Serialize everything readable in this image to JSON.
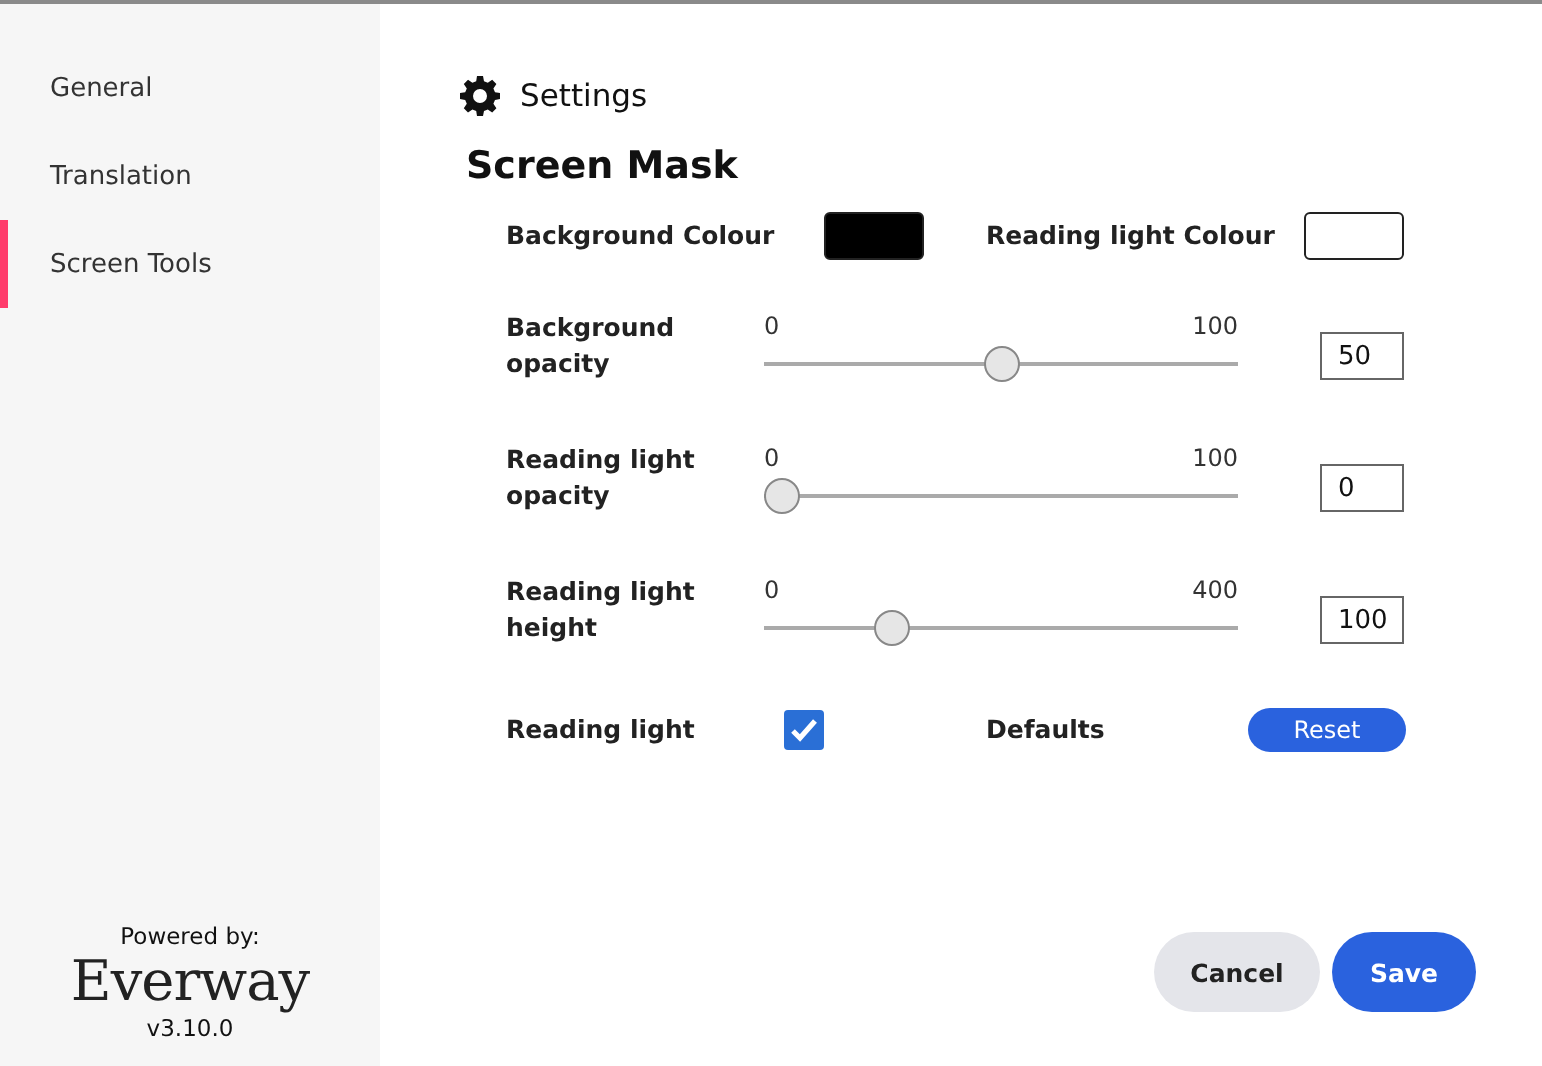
{
  "sidebar": {
    "items": [
      {
        "label": "General",
        "selected": false
      },
      {
        "label": "Translation",
        "selected": false
      },
      {
        "label": "Screen Tools",
        "selected": true
      }
    ],
    "footer": {
      "powered_by": "Powered by:",
      "logo": "Everway",
      "version": "v3.10.0"
    }
  },
  "header": {
    "title": "Settings"
  },
  "section": {
    "title": "Screen Mask"
  },
  "colours": [
    {
      "label": "Background Colour",
      "color": "#000000"
    },
    {
      "label": "Reading light Colour",
      "color": "#ffffff"
    }
  ],
  "sliders": [
    {
      "label": "Background opacity",
      "min": "0",
      "max": "100",
      "level": 0.5,
      "value": "50"
    },
    {
      "label": "Reading light opacity",
      "min": "0",
      "max": "100",
      "level": 0,
      "value": "0"
    },
    {
      "label": "Reading light height",
      "min": "0",
      "max": "400",
      "level": 0.25,
      "value": "100"
    }
  ],
  "reading_light": {
    "label": "Reading light",
    "checked": true
  },
  "defaults": {
    "label": "Defaults",
    "button": "Reset"
  },
  "buttons": {
    "cancel": "Cancel",
    "save": "Save"
  }
}
